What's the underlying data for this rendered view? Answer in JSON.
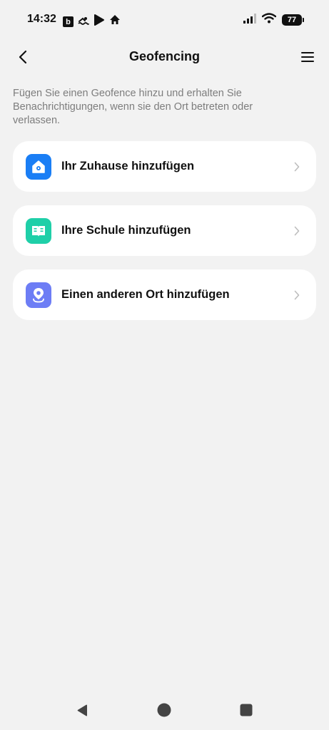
{
  "status_bar": {
    "time": "14:32",
    "app_badge_letter": "b",
    "battery_level": "77"
  },
  "header": {
    "title": "Geofencing"
  },
  "description": "Fügen Sie einen Geofence hinzu und erhalten Sie Benachrichtigungen, wenn sie den Ort betreten oder verlassen.",
  "items": [
    {
      "label": "Ihr Zuhause hinzufügen",
      "icon": "home-icon",
      "icon_color": "#1a7ef5"
    },
    {
      "label": "Ihre Schule hinzufügen",
      "icon": "book-icon",
      "icon_color": "#1fcfa8"
    },
    {
      "label": "Einen anderen Ort hinzufügen",
      "icon": "location-pin-icon",
      "icon_color": "#6d7df5"
    }
  ],
  "colors": {
    "background": "#f2f2f2",
    "card": "#ffffff",
    "description_text": "#7d7d7d"
  }
}
